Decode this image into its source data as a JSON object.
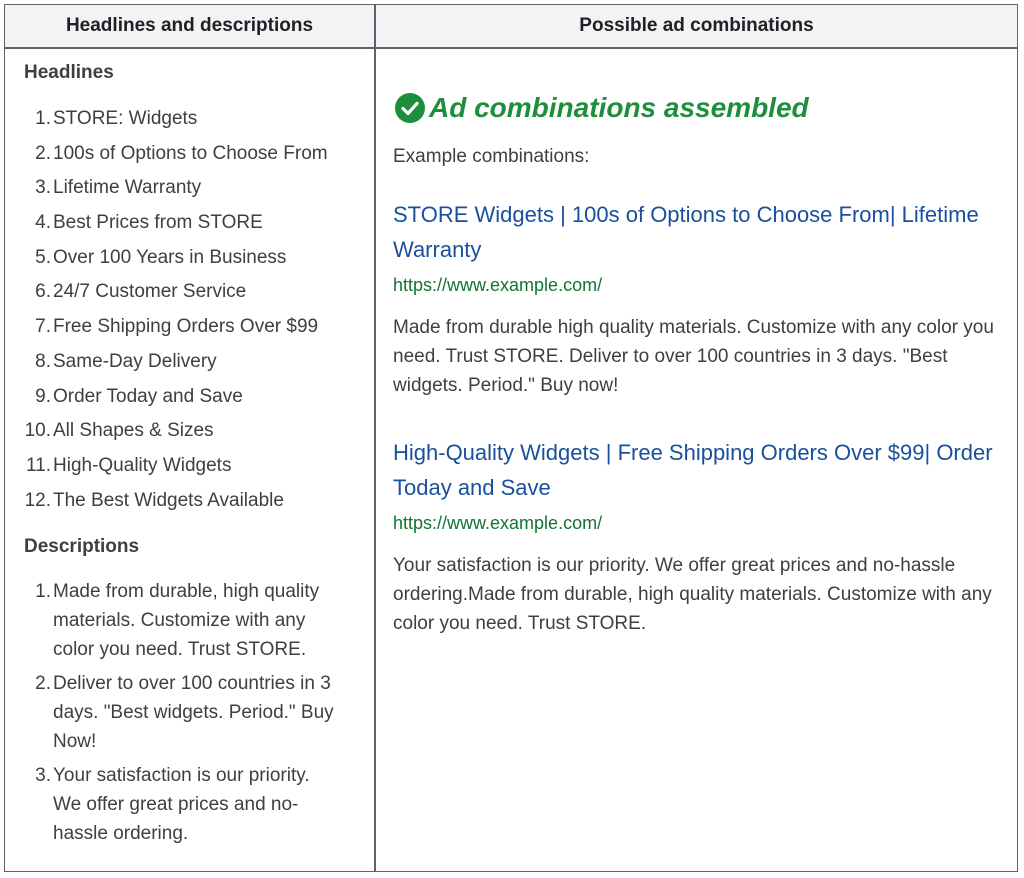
{
  "table": {
    "left_header": "Headlines and descriptions",
    "right_header": "Possible ad combinations"
  },
  "headlines": {
    "title": "Headlines",
    "items": [
      {
        "num": "1.",
        "text": "STORE: Widgets"
      },
      {
        "num": "2.",
        "text": "100s of Options to Choose From"
      },
      {
        "num": "3.",
        "text": "Lifetime Warranty"
      },
      {
        "num": "4.",
        "text": "Best Prices from STORE"
      },
      {
        "num": "5.",
        "text": "Over 100 Years in Business"
      },
      {
        "num": "6.",
        "text": "24/7 Customer Service"
      },
      {
        "num": "7.",
        "text": "Free Shipping Orders Over $99"
      },
      {
        "num": "8.",
        "text": "Same-Day Delivery"
      },
      {
        "num": "9.",
        "text": "Order Today and Save"
      },
      {
        "num": "10.",
        "text": "All Shapes & Sizes"
      },
      {
        "num": "11.",
        "text": "High-Quality Widgets"
      },
      {
        "num": "12.",
        "text": "The Best Widgets Available"
      }
    ]
  },
  "descriptions": {
    "title": "Descriptions",
    "items": [
      {
        "num": "1.",
        "text": "Made from durable, high quality materials. Customize with any color you need. Trust STORE."
      },
      {
        "num": "2.",
        "text": "Deliver to over 100 countries in 3 days. \"Best widgets. Period.\" Buy Now!"
      },
      {
        "num": "3.",
        "text": "Your satisfaction is our priority. We offer great prices and no-hassle ordering."
      }
    ]
  },
  "combinations": {
    "status": "Ad combinations assembled",
    "status_icon": "check-circle-icon",
    "example_label": "Example combinations:",
    "ads": [
      {
        "title": "STORE Widgets | 100s of Options to Choose From| Lifetime Warranty",
        "url": "https://www.example.com/",
        "description": "Made from durable high quality materials. Customize with any color you need. Trust STORE. Deliver to over 100 countries in 3 days. \"Best widgets. Period.\" Buy now!"
      },
      {
        "title": "High-Quality Widgets | Free Shipping Orders Over $99| Order Today and Save",
        "url": "https://www.example.com/",
        "description": "Your satisfaction is our priority. We offer great prices and no-hassle ordering.Made from durable, high quality materials. Customize with any color you need. Trust STORE."
      }
    ]
  },
  "colors": {
    "link_blue": "#1a4f9c",
    "url_green": "#137333",
    "status_green": "#1e8e3e",
    "border": "#5f6368",
    "header_bg": "#f1f3f4"
  }
}
